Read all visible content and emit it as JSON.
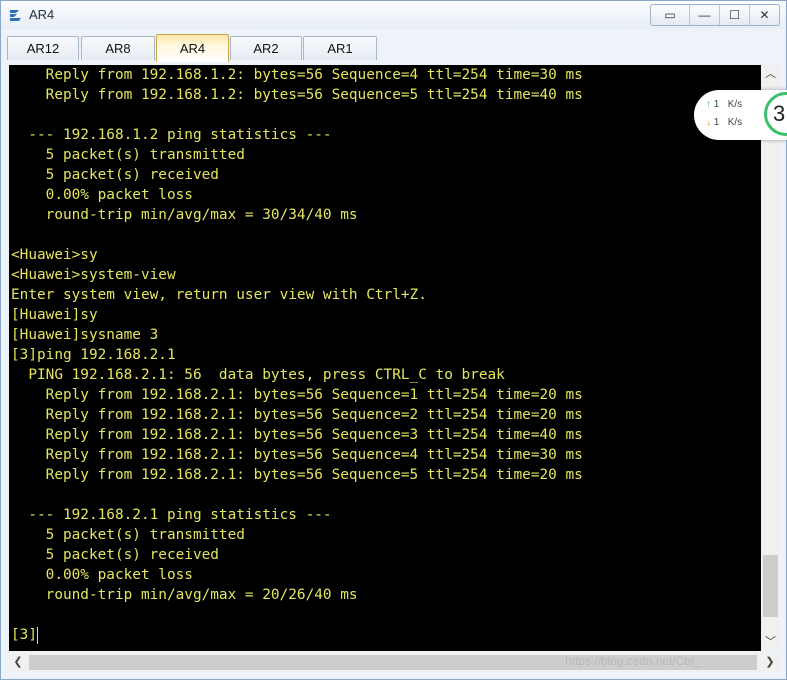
{
  "window": {
    "title": "AR4",
    "icon": "ensp-router-icon"
  },
  "window_controls": [
    {
      "name": "restore-layout-button",
      "glyph": "▭"
    },
    {
      "name": "minimize-button",
      "glyph": "—"
    },
    {
      "name": "maximize-button",
      "glyph": "☐"
    },
    {
      "name": "close-button",
      "glyph": "✕"
    }
  ],
  "tabs": [
    {
      "label": "AR12",
      "active": false
    },
    {
      "label": "AR8",
      "active": false
    },
    {
      "label": "AR4",
      "active": true
    },
    {
      "label": "AR2",
      "active": false
    },
    {
      "label": "AR1",
      "active": false
    }
  ],
  "terminal": {
    "lines": [
      "    Reply from 192.168.1.2: bytes=56 Sequence=4 ttl=254 time=30 ms",
      "    Reply from 192.168.1.2: bytes=56 Sequence=5 ttl=254 time=40 ms",
      "",
      "  --- 192.168.1.2 ping statistics ---",
      "    5 packet(s) transmitted",
      "    5 packet(s) received",
      "    0.00% packet loss",
      "    round-trip min/avg/max = 30/34/40 ms",
      "",
      "<Huawei>sy",
      "<Huawei>system-view",
      "Enter system view, return user view with Ctrl+Z.",
      "[Huawei]sy",
      "[Huawei]sysname 3",
      "[3]ping 192.168.2.1",
      "  PING 192.168.2.1: 56  data bytes, press CTRL_C to break",
      "    Reply from 192.168.2.1: bytes=56 Sequence=1 ttl=254 time=20 ms",
      "    Reply from 192.168.2.1: bytes=56 Sequence=2 ttl=254 time=20 ms",
      "    Reply from 192.168.2.1: bytes=56 Sequence=3 ttl=254 time=40 ms",
      "    Reply from 192.168.2.1: bytes=56 Sequence=4 ttl=254 time=30 ms",
      "    Reply from 192.168.2.1: bytes=56 Sequence=5 ttl=254 time=20 ms",
      "",
      "  --- 192.168.2.1 ping statistics ---",
      "    5 packet(s) transmitted",
      "    5 packet(s) received",
      "    0.00% packet loss",
      "    round-trip min/avg/max = 20/26/40 ms",
      "",
      "[3]"
    ],
    "text_color": "#e5e55e",
    "background": "#000000"
  },
  "net_speed": {
    "up": "1",
    "up_unit": "K/s",
    "down": "1",
    "down_unit": "K/s",
    "badge": "3"
  },
  "watermark": "https://blog.csdn.net/Ctrl_"
}
